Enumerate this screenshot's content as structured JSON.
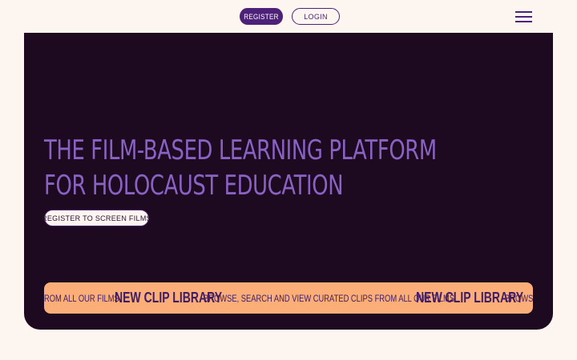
{
  "header": {
    "register_label": "Register",
    "login_label": "Login",
    "menu_icon": "hamburger-menu-icon"
  },
  "hero": {
    "headline_line1": "The film-based learning platform",
    "headline_line2": "for Holocaust education",
    "cta_label": "Register to screen films"
  },
  "ticker": {
    "item1": "rom all our films",
    "item2": "New clip library",
    "item3": "Browse, search and view curated clips from all our films",
    "item4": "New clip library",
    "item5": "Browse."
  },
  "colors": {
    "page_bg": "#fdf6f0",
    "hero_bg": "#1d0a21",
    "accent_purple": "#4c2177",
    "headline_purple": "#8a62c4",
    "ticker_bg": "#fbae77"
  }
}
